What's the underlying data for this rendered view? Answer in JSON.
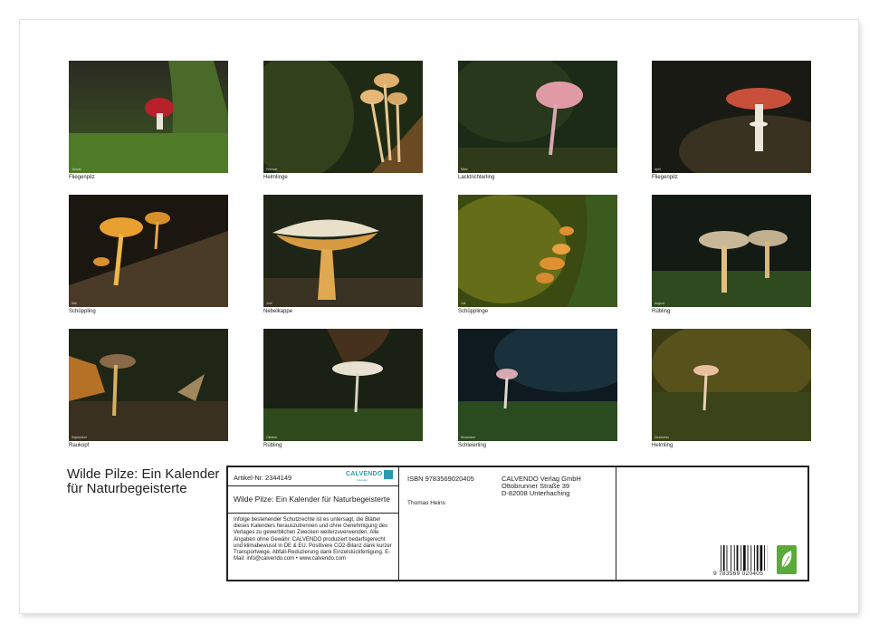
{
  "photos": [
    {
      "caption": "Fliegenpilz",
      "label": "Januar"
    },
    {
      "caption": "Helmlinge",
      "label": "Februar"
    },
    {
      "caption": "Lacktrichterling",
      "label": "März"
    },
    {
      "caption": "Fliegenpilz",
      "label": "April"
    },
    {
      "caption": "Schüppling",
      "label": "Mai"
    },
    {
      "caption": "Nebelkappe",
      "label": "Juni"
    },
    {
      "caption": "Schüpplinge",
      "label": "Juli"
    },
    {
      "caption": "Rübling",
      "label": "August"
    },
    {
      "caption": "Raukopf",
      "label": "September"
    },
    {
      "caption": "Rübling",
      "label": "Oktober"
    },
    {
      "caption": "Schleierling",
      "label": "November"
    },
    {
      "caption": "Helmling",
      "label": "Dezember"
    }
  ],
  "title": "Wilde Pilze: Ein Kalender für Naturbegeisterte",
  "info": {
    "artikel": "Artikel-Nr. 2344149",
    "publisher_logo": "CALVENDO",
    "publisher_logo_sub": "Kalender",
    "product_title": "Wilde Pilze: Ein Kalender für Naturbegeisterte",
    "legal": "Infolge bestehender Schutzrechte ist es untersagt, die Blätter dieses Kalenders herauszutrennen und ohne Genehmigung des Verlages zu gewerblichen Zwecken weiterzuverwenden. Alle Angaben ohne Gewähr. CALVENDO produziert bedarfsgerecht und klimabewusst in DE & EU. Positivere CO2-Bilanz dank kurzer Transportwege. Abfall-Reduzierung dank Einzelstückfertigung. E-Mail: info@calvendo.com • www.calvendo.com",
    "isbn": "ISBN 9783569020405",
    "author": "Thomas Heins",
    "publisher_name": "CALVENDO Verlag GmbH",
    "publisher_street": "Ottobrunner Straße 39",
    "publisher_city": "D-82008 Unterhaching",
    "barcode_number": "9 783569 020405"
  },
  "colors": {
    "eco_badge": "#5aaa3a",
    "calvendo_blue": "#2a9ab0"
  }
}
